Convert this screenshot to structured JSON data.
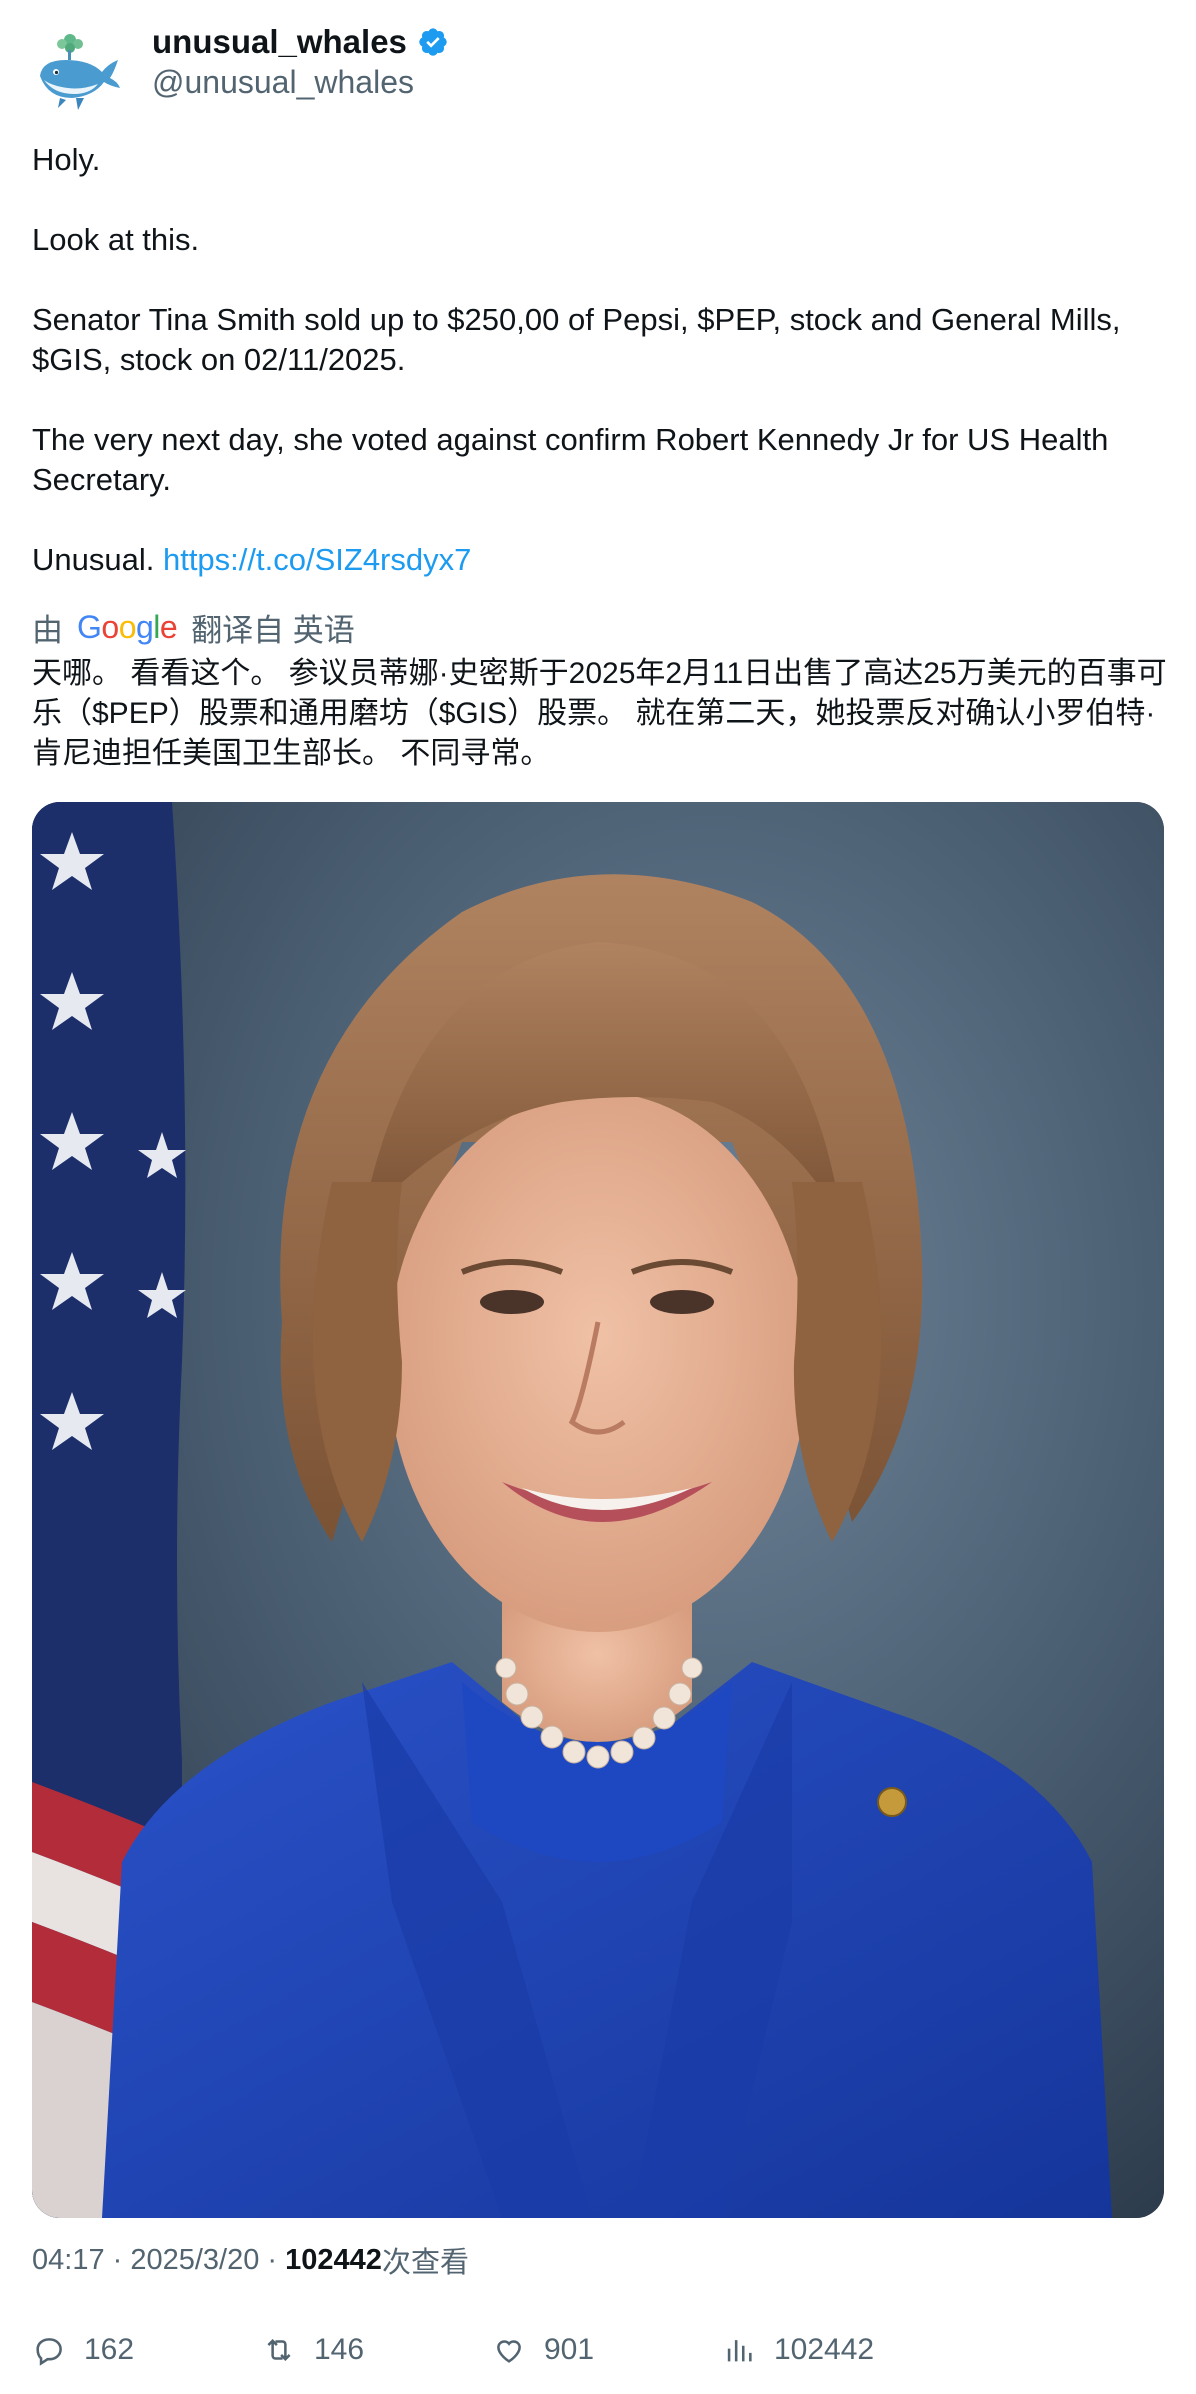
{
  "author": {
    "display_name": "unusual_whales",
    "handle": "@unusual_whales",
    "verified": true
  },
  "tweet": {
    "line1": "Holy.",
    "line2": "Look at this.",
    "line3": "Senator Tina Smith sold up to $250,00 of Pepsi, $PEP, stock and General Mills, $GIS, stock on 02/11/2025.",
    "line4": "The very next day, she voted against confirm Robert Kennedy Jr for US Health Secretary.",
    "line5_prefix": "Unusual. ",
    "link": "https://t.co/SIZ4rsdyx7"
  },
  "translation": {
    "by": "由",
    "provider": "Google",
    "from_label": "翻译自 英语",
    "text": "天哪。 看看这个。 参议员蒂娜·史密斯于2025年2月11日出售了高达25万美元的百事可乐（$PEP）股票和通用磨坊（$GIS）股票。 就在第二天，她投票反对确认小罗伯特·肯尼迪担任美国卫生部长。 不同寻常。"
  },
  "meta": {
    "time": "04:17",
    "sep1": " · ",
    "date": "2025/3/20",
    "sep2": " · ",
    "views": "102442",
    "views_suffix": "次查看"
  },
  "actions": {
    "replies": "162",
    "retweets": "146",
    "likes": "901",
    "views": "102442"
  },
  "colors": {
    "link": "#1d9bf0",
    "secondary_text": "#536471",
    "verified_badge": "#1d9bf0",
    "jacket_blue": "#1f45b8"
  },
  "icons": [
    "verified-badge-icon",
    "reply-icon",
    "retweet-icon",
    "like-icon",
    "views-icon"
  ]
}
